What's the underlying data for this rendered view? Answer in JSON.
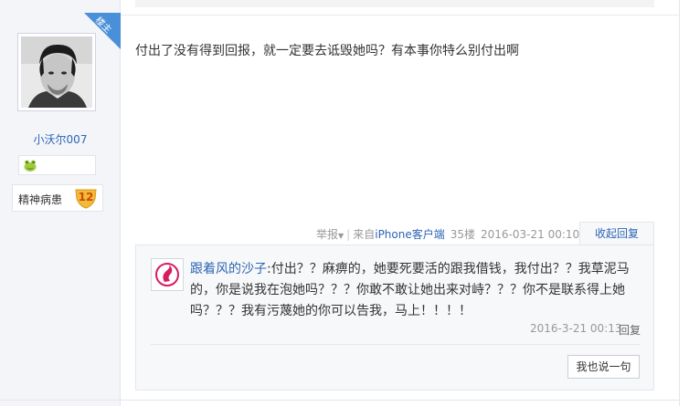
{
  "author": {
    "corner_tag": "楼主",
    "username": "小沃尔007",
    "badge_label": "精神病患",
    "badge_level": "12",
    "level_icon": "green-frog-icon"
  },
  "post": {
    "content": "付出了没有得到回报，就一定要去诋毁她吗？有本事你特么别付出啊"
  },
  "meta": {
    "report": "举报",
    "report_arrow": "▼",
    "source_prefix": "来自",
    "source_app": "iPhone客户端",
    "floor": "35楼",
    "date": "2016-03-21 00:10",
    "collapse_label": "收起回复"
  },
  "reply": {
    "author": "跟着风的沙子",
    "text": "付出？？麻痹的，她要死要活的跟我借钱，我付出？？我草泥马的，你是说我在泡她吗？？？你敢不敢让她出来对峙？？？你不是联系得上她吗？？？我有污蔑她的你可以告我，马上！！！！",
    "time": "2016-3-21 00:13",
    "reply_label": "回复",
    "say_button": "我也说一句"
  },
  "colors": {
    "link": "#2d64b3",
    "corner_tag": "#4a90d9",
    "badge": "#f4b93a",
    "sidebar_bg": "#f3f5f9"
  }
}
